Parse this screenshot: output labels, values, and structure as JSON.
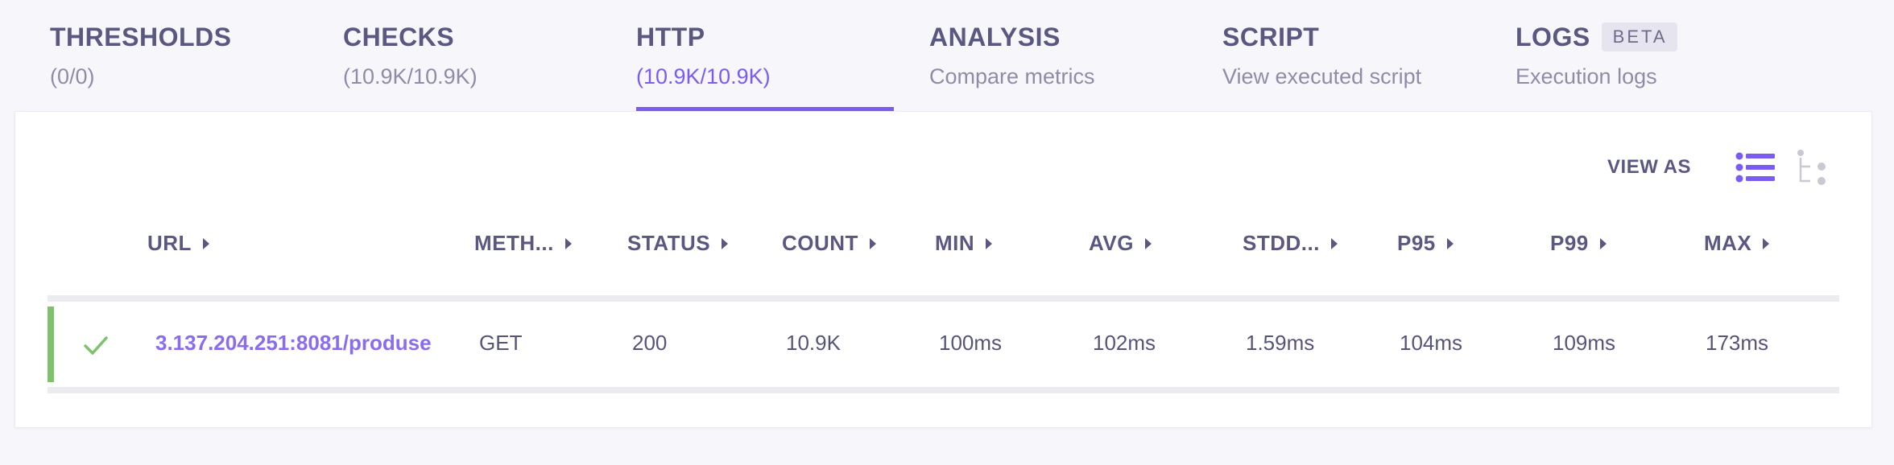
{
  "tabs": [
    {
      "title": "THRESHOLDS",
      "sub": "(0/0)",
      "active": false
    },
    {
      "title": "CHECKS",
      "sub": "(10.9K/10.9K)",
      "active": false
    },
    {
      "title": "HTTP",
      "sub": "(10.9K/10.9K)",
      "active": true
    },
    {
      "title": "ANALYSIS",
      "sub": "Compare metrics",
      "active": false
    },
    {
      "title": "SCRIPT",
      "sub": "View executed script",
      "active": false
    },
    {
      "title": "LOGS",
      "badge": "BETA",
      "sub": "Execution logs",
      "active": false
    }
  ],
  "view_as": {
    "label": "VIEW AS",
    "options": [
      "list-view-icon",
      "tree-view-icon"
    ],
    "selected": "list-view-icon"
  },
  "table": {
    "columns": [
      "URL",
      "METH...",
      "STATUS",
      "COUNT",
      "MIN",
      "AVG",
      "STDD...",
      "P95",
      "P99",
      "MAX"
    ],
    "rows": [
      {
        "url": "3.137.204.251:8081/produse",
        "method": "GET",
        "status": "200",
        "count": "10.9K",
        "min": "100ms",
        "avg": "102ms",
        "stddev": "1.59ms",
        "p95": "104ms",
        "p99": "109ms",
        "max": "173ms"
      }
    ]
  },
  "colors": {
    "accent": "#7b5cf0",
    "success": "#7ec36c",
    "text": "#5a5880"
  }
}
